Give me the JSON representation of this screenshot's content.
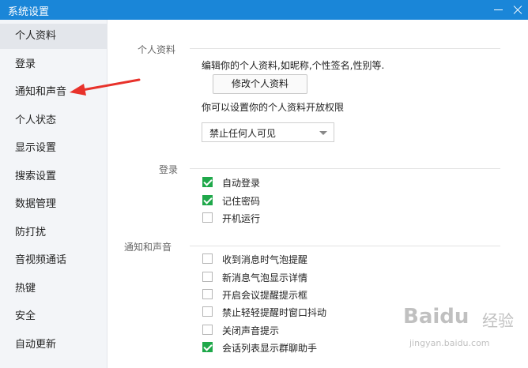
{
  "window": {
    "title": "系统设置"
  },
  "sidebar": {
    "items": [
      {
        "label": "个人资料",
        "active": true
      },
      {
        "label": "登录"
      },
      {
        "label": "通知和声音"
      },
      {
        "label": "个人状态"
      },
      {
        "label": "显示设置"
      },
      {
        "label": "搜索设置"
      },
      {
        "label": "数据管理"
      },
      {
        "label": "防打扰"
      },
      {
        "label": "音视频通话"
      },
      {
        "label": "热键"
      },
      {
        "label": "安全"
      },
      {
        "label": "自动更新"
      }
    ]
  },
  "profile": {
    "section_label": "个人资料",
    "description": "编辑你的个人资料,如昵称,个性签名,性别等.",
    "edit_button": "修改个人资料",
    "permission_text": "你可以设置你的个人资料开放权限",
    "permission_select": "禁止任何人可见"
  },
  "login": {
    "section_label": "登录",
    "options": [
      {
        "label": "自动登录",
        "checked": true
      },
      {
        "label": "记住密码",
        "checked": true
      },
      {
        "label": "开机运行",
        "checked": false
      }
    ]
  },
  "notify": {
    "section_label": "通知和声音",
    "options": [
      {
        "label": "收到消息时气泡提醒",
        "checked": false
      },
      {
        "label": "新消息气泡显示详情",
        "checked": false
      },
      {
        "label": "开启会议提醒提示框",
        "checked": false
      },
      {
        "label": "禁止轻轻提醒时窗口抖动",
        "checked": false
      },
      {
        "label": "关闭声音提示",
        "checked": false
      },
      {
        "label": "会话列表显示群聊助手",
        "checked": true
      }
    ]
  },
  "watermark": {
    "brand": "Baidu",
    "cn": "经验",
    "url": "jingyan.baidu.com"
  },
  "colors": {
    "titlebar": "#1a86d8",
    "annotation_arrow": "#e8322b",
    "checkbox_checked": "#1fa84a"
  }
}
